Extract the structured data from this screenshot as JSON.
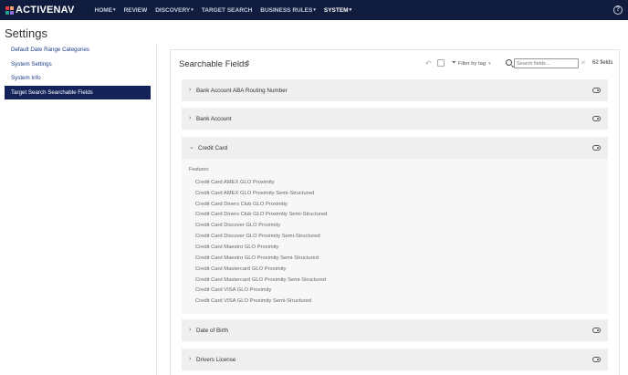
{
  "brand": {
    "name": "ACTIVENAV"
  },
  "nav": {
    "items": [
      {
        "label": "HOME",
        "caret": "▾",
        "active": false
      },
      {
        "label": "REVIEW",
        "caret": "",
        "active": false
      },
      {
        "label": "DISCOVERY",
        "caret": "▾",
        "active": false
      },
      {
        "label": "TARGET SEARCH",
        "caret": "",
        "active": false
      },
      {
        "label": "BUSINESS RULES",
        "caret": "▾",
        "active": false
      },
      {
        "label": "SYSTEM",
        "caret": "▾",
        "active": true
      }
    ],
    "help_icon": "help-circle-icon",
    "help_glyph": "?"
  },
  "page": {
    "title": "Settings"
  },
  "sidebar": {
    "items": [
      {
        "label": "Default Date Range Categories",
        "active": false
      },
      {
        "label": "System Settings",
        "active": false
      },
      {
        "label": "System Info",
        "active": false
      },
      {
        "label": "Target Search Searchable Fields",
        "active": true
      }
    ],
    "active_color": "#13235a"
  },
  "panel": {
    "title": "Searchable Fields",
    "filter_label": "Filter by tag",
    "search_placeholder": "Search fields...",
    "count_label": "62 fields",
    "glyphs": {
      "sort": "⇕",
      "undo": "↶",
      "tag": "⏷",
      "chevron": "▾",
      "clear": "✕"
    }
  },
  "fields": [
    {
      "label": "Bank Account ABA Routing Number",
      "expanded": false,
      "enabled": true
    },
    {
      "label": "Bank Account",
      "expanded": false,
      "enabled": true
    },
    {
      "label": "Credit Card",
      "expanded": true,
      "enabled": true
    },
    {
      "label": "Date of Birth",
      "expanded": false,
      "enabled": true
    },
    {
      "label": "Drivers License",
      "expanded": false,
      "enabled": true
    }
  ],
  "expanded": {
    "features_label": "Features:",
    "features": [
      "Credit Card AMEX GLO Proximity",
      "Credit Card AMEX GLO Proximity Semi-Structured",
      "Credit Card Diners Club GLO Proximity",
      "Credit Card Diners Club GLO Proximity Semi-Structured",
      "Credit Card Discover GLO Proximity",
      "Credit Card Discover GLO Proximity Semi-Structured",
      "Credit Card Maestro GLO Proximity",
      "Credit Card Maestro GLO Proximity Semi-Structured",
      "Credit Card Mastercard GLO Proximity",
      "Credit Card Mastercard GLO Proximity Semi-Structured",
      "Credit Card VISA GLO Proximity",
      "Credit Card VISA GLO Proximity Semi-Structured"
    ]
  },
  "glyphs": {
    "collapsed": "›",
    "expanded": "⌄"
  }
}
